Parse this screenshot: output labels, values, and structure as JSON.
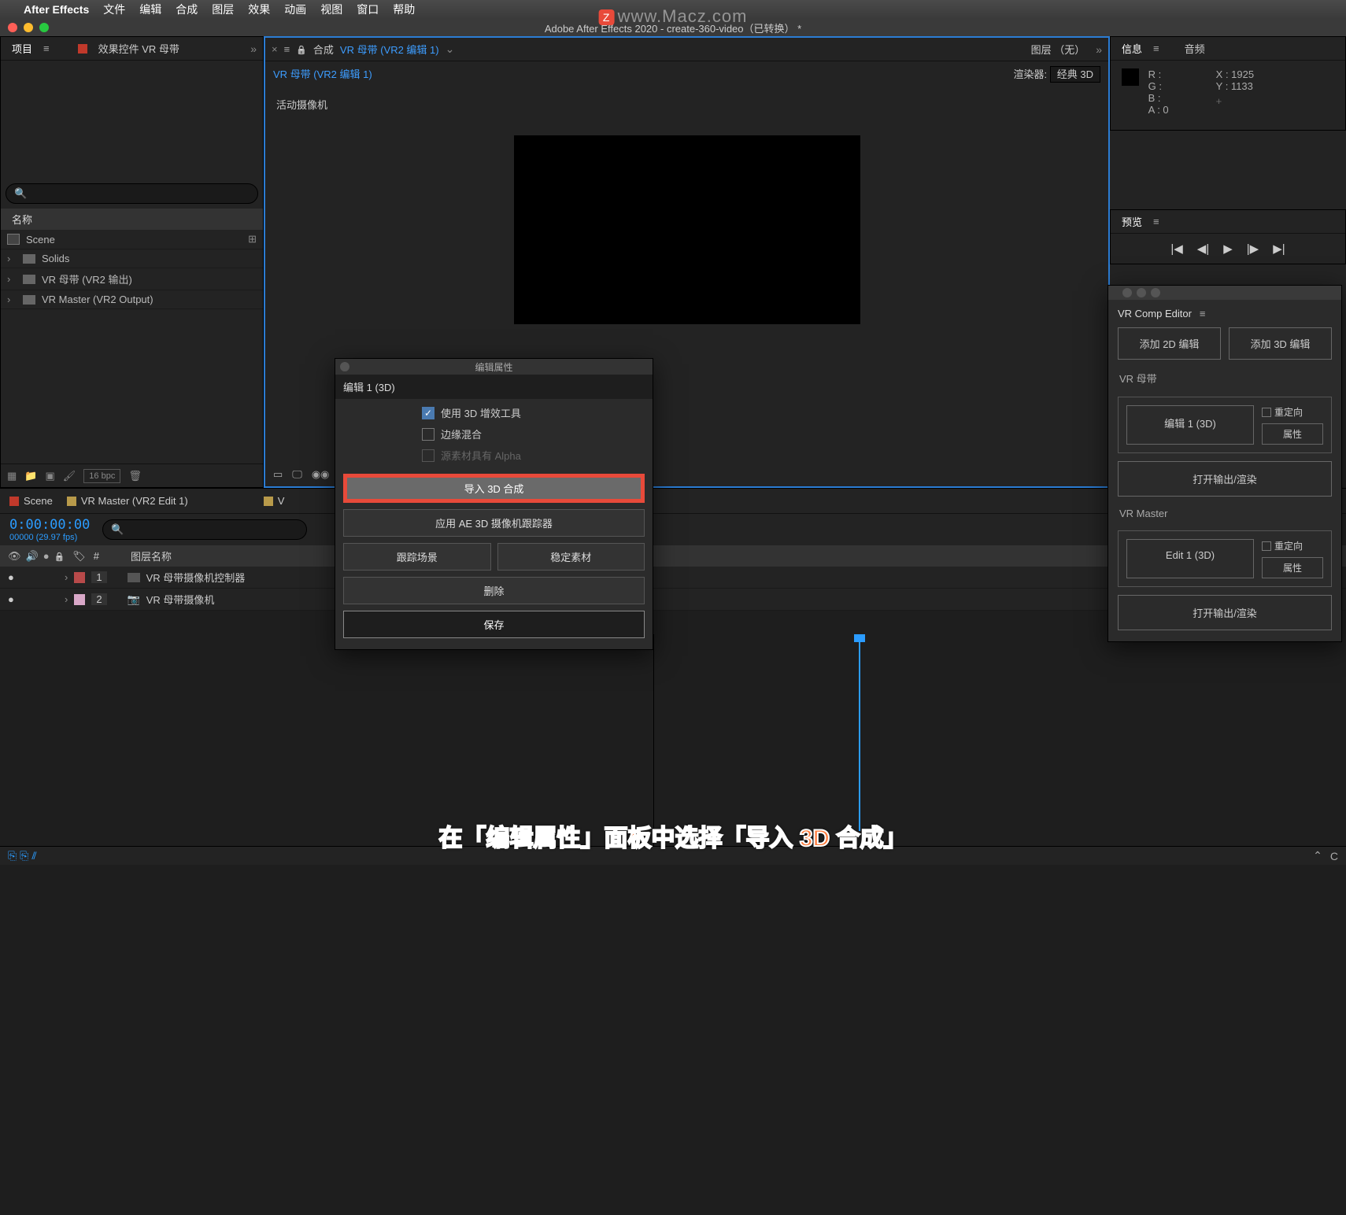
{
  "watermark": "www.Macz.com",
  "mac_menu": {
    "app": "After Effects",
    "items": [
      "文件",
      "编辑",
      "合成",
      "图层",
      "效果",
      "动画",
      "视图",
      "窗口",
      "帮助"
    ]
  },
  "app_title": "Adobe After Effects 2020 - create-360-video（已转换） *",
  "project_panel": {
    "tab": "项目",
    "fx_tab": "效果控件 VR 母带",
    "search_placeholder": "",
    "col_name": "名称",
    "items": [
      {
        "type": "comp",
        "label": "Scene"
      },
      {
        "type": "folder",
        "label": "Solids"
      },
      {
        "type": "folder",
        "label": "VR 母带 (VR2 输出)"
      },
      {
        "type": "folder",
        "label": "VR Master (VR2 Output)"
      }
    ],
    "bpc": "16 bpc"
  },
  "comp_panel": {
    "prefix": "合成",
    "title": "VR 母带 (VR2 编辑 1)",
    "layer_tab": "图层 （无）",
    "flow_name": "VR 母带 (VR2 编辑 1)",
    "renderer_label": "渲染器:",
    "renderer_value": "经典 3D",
    "active_camera": "活动摄像机"
  },
  "info_panel": {
    "tab_info": "信息",
    "tab_audio": "音频",
    "r": "R :",
    "g": "G :",
    "b": "B :",
    "a": "A :  0",
    "x": "X : 1925",
    "y": "Y : 1133"
  },
  "preview_panel": {
    "tab": "预览"
  },
  "timeline": {
    "tabs": [
      "Scene",
      "VR Master (VR2 Edit 1)",
      "V"
    ],
    "timecode": "0:00:00:00",
    "frames": "00000 (29.97 fps)",
    "search_placeholder": "",
    "col_num": "#",
    "col_layer": "图层名称",
    "layers": [
      {
        "num": "1",
        "color": "c-red",
        "name": "VR 母带摄像机控制器"
      },
      {
        "num": "2",
        "color": "c-pink",
        "name": "VR 母带摄像机"
      }
    ]
  },
  "edit_props": {
    "title": "编辑属性",
    "section": "编辑 1 (3D)",
    "opt_3d_tools": "使用 3D 增效工具",
    "opt_edge_blend": "边缘混合",
    "opt_alpha": "源素材具有 Alpha",
    "btn_import_3d": "导入 3D 合成",
    "btn_apply_tracker": "应用 AE 3D 摄像机跟踪器",
    "btn_track_scene": "跟踪场景",
    "btn_stabilize": "稳定素材",
    "btn_delete": "删除",
    "btn_save": "保存"
  },
  "vr_editor": {
    "title": "VR Comp Editor",
    "add_2d": "添加 2D 编辑",
    "add_3d": "添加 3D 编辑",
    "section_master_cn": "VR 母带",
    "edit1_cn": "编辑 1 (3D)",
    "reorient": "重定向",
    "props": "属性",
    "open_output": "打开输出/渲染",
    "section_master_en": "VR Master",
    "edit1_en": "Edit 1 (3D)"
  },
  "caption": "在「编辑属性」面板中选择「导入 3D 合成」",
  "footer": {
    "c": "C"
  }
}
